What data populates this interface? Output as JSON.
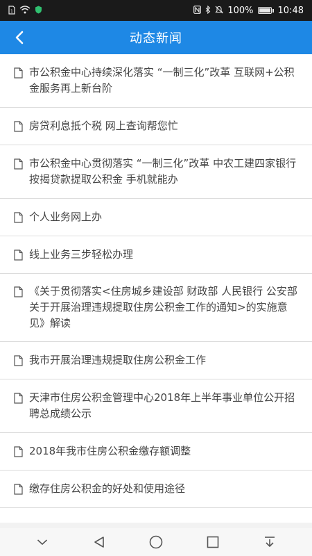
{
  "status_bar": {
    "battery": "100%",
    "battery_level": 1.0,
    "time": "10:48",
    "icons": [
      "sim-icon",
      "wifi-icon",
      "shield-icon",
      "nfc-icon",
      "bluetooth-icon",
      "mute-icon",
      "battery-icon"
    ]
  },
  "header": {
    "title": "动态新闻",
    "back_icon": "chevron-left-icon"
  },
  "news": {
    "items": [
      {
        "title": "市公积金中心持续深化落实 “一制三化”改革 互联网+公积金服务再上新台阶"
      },
      {
        "title": "房贷利息抵个税 网上查询帮您忙"
      },
      {
        "title": "市公积金中心贯彻落实 “一制三化”改革 中农工建四家银行按揭贷款提取公积金 手机就能办"
      },
      {
        "title": "个人业务网上办"
      },
      {
        "title": "线上业务三步轻松办理"
      },
      {
        "title": "《关于贯彻落实<住房城乡建设部 财政部 人民银行 公安部关于开展治理违规提取住房公积金工作的通知>的实施意见》解读"
      },
      {
        "title": "我市开展治理违规提取住房公积金工作"
      },
      {
        "title": "天津市住房公积金管理中心2018年上半年事业单位公开招聘总成绩公示"
      },
      {
        "title": "2018年我市住房公积金缴存额调整"
      },
      {
        "title": "缴存住房公积金的好处和使用途径"
      }
    ]
  },
  "nav_bar": {
    "icons": [
      "chevron-down-icon",
      "back-triangle-icon",
      "home-circle-icon",
      "recents-square-icon",
      "notification-pulldown-icon"
    ]
  },
  "colors": {
    "header_bg": "#1e88e5",
    "status_bg": "#1a1a1a",
    "text": "#444444",
    "divider": "#dcdcdc"
  }
}
